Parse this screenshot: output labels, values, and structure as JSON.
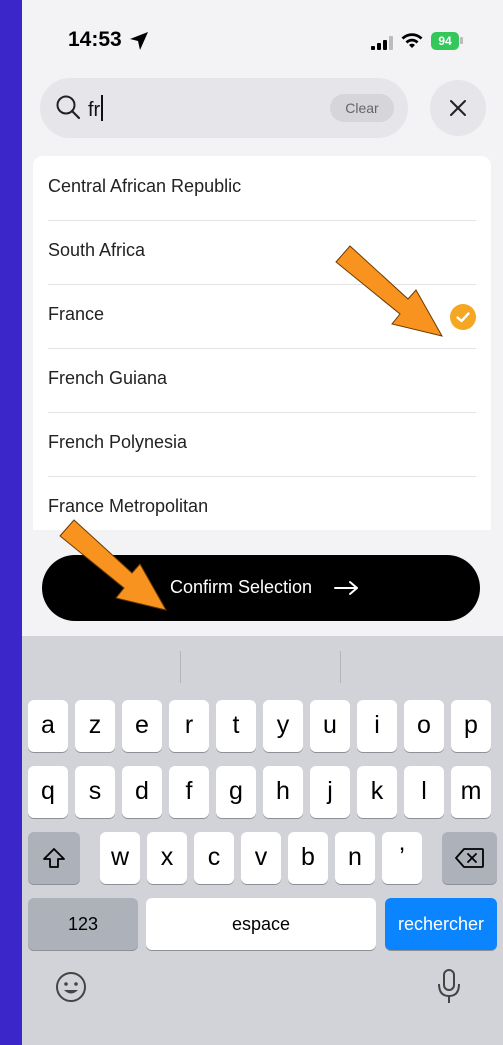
{
  "status_bar": {
    "time": "14:53",
    "battery": "94"
  },
  "search": {
    "value": "fr",
    "clear_label": "Clear"
  },
  "countries": [
    {
      "name": "Central African Republic",
      "selected": false
    },
    {
      "name": "South Africa",
      "selected": false
    },
    {
      "name": "France",
      "selected": true
    },
    {
      "name": "French Guiana",
      "selected": false
    },
    {
      "name": "French Polynesia",
      "selected": false
    },
    {
      "name": "France Metropolitan",
      "selected": false
    }
  ],
  "confirm": {
    "label": "Confirm Selection"
  },
  "keyboard": {
    "row1": [
      "a",
      "z",
      "e",
      "r",
      "t",
      "y",
      "u",
      "i",
      "o",
      "p"
    ],
    "row2": [
      "q",
      "s",
      "d",
      "f",
      "g",
      "h",
      "j",
      "k",
      "l",
      "m"
    ],
    "row3": [
      "w",
      "x",
      "c",
      "v",
      "b",
      "n",
      "’"
    ],
    "numbers_label": "123",
    "space_label": "espace",
    "search_label": "rechercher"
  },
  "colors": {
    "accent": "#f5a623",
    "annotation": "#f7931e",
    "background": "#3a26c9",
    "return_key": "#0a84ff"
  }
}
